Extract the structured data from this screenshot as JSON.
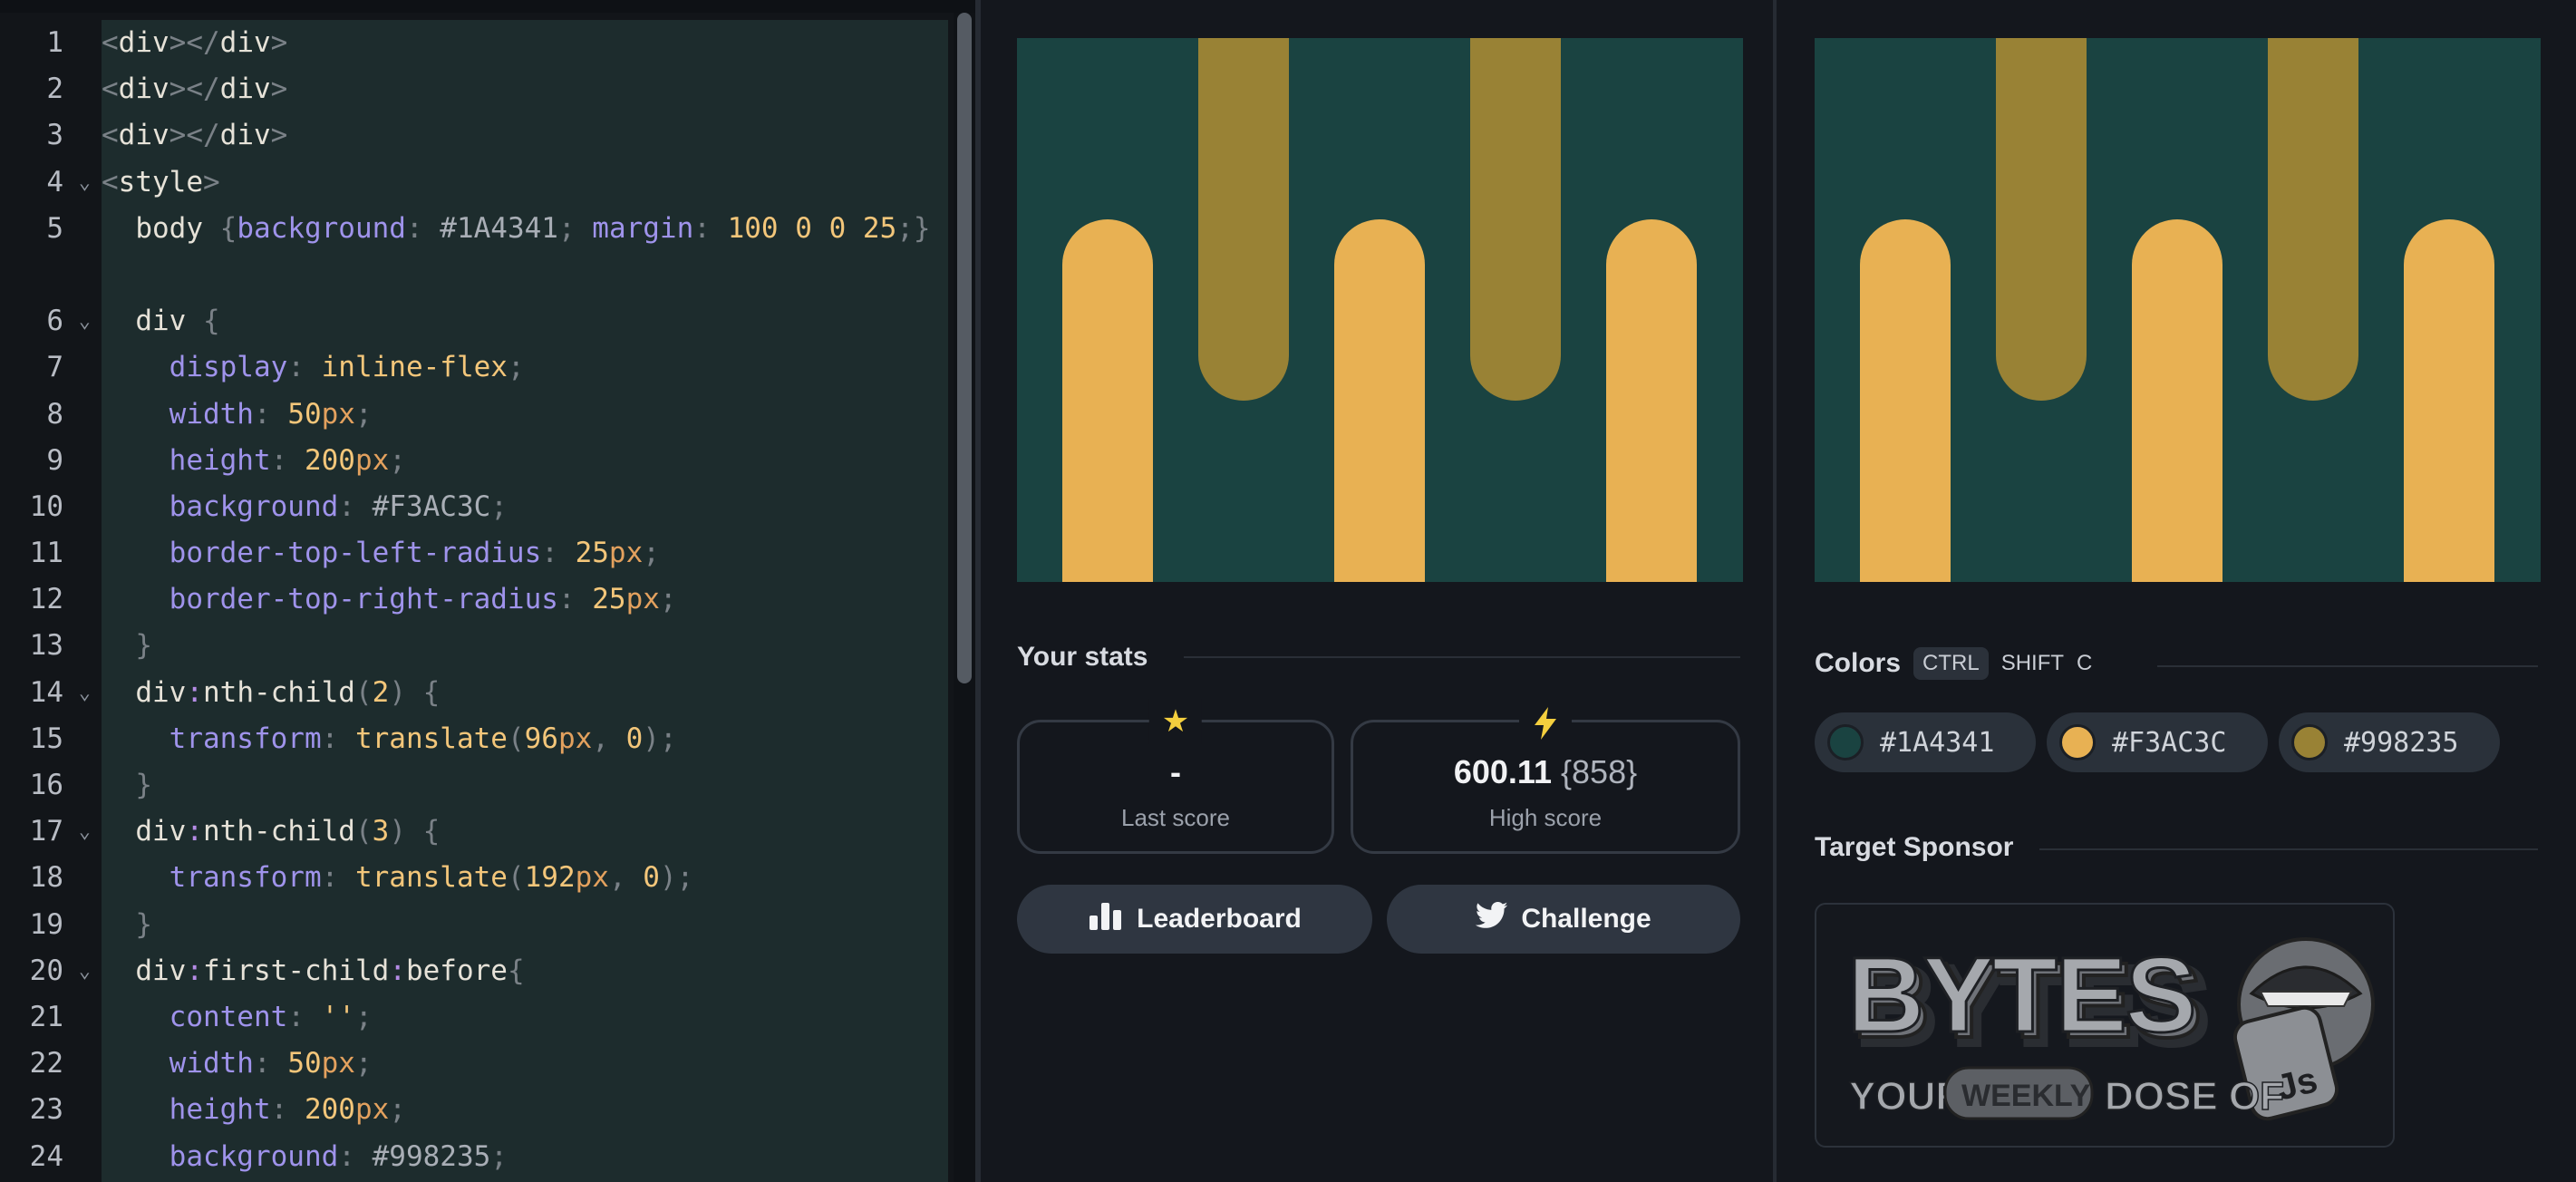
{
  "editor": {
    "lines": [
      {
        "n": "1",
        "fold": ""
      },
      {
        "n": "2",
        "fold": ""
      },
      {
        "n": "3",
        "fold": ""
      },
      {
        "n": "4",
        "fold": "⌄"
      },
      {
        "n": "5",
        "fold": "",
        "wrap": true
      },
      {
        "n": "6",
        "fold": "⌄"
      },
      {
        "n": "7",
        "fold": ""
      },
      {
        "n": "8",
        "fold": ""
      },
      {
        "n": "9",
        "fold": ""
      },
      {
        "n": "10",
        "fold": ""
      },
      {
        "n": "11",
        "fold": ""
      },
      {
        "n": "12",
        "fold": ""
      },
      {
        "n": "13",
        "fold": ""
      },
      {
        "n": "14",
        "fold": "⌄"
      },
      {
        "n": "15",
        "fold": ""
      },
      {
        "n": "16",
        "fold": ""
      },
      {
        "n": "17",
        "fold": "⌄"
      },
      {
        "n": "18",
        "fold": ""
      },
      {
        "n": "19",
        "fold": ""
      },
      {
        "n": "20",
        "fold": "⌄"
      },
      {
        "n": "21",
        "fold": ""
      },
      {
        "n": "22",
        "fold": ""
      },
      {
        "n": "23",
        "fold": ""
      },
      {
        "n": "24",
        "fold": ""
      }
    ],
    "code": [
      [
        [
          "pn",
          "<"
        ],
        [
          "sel",
          "div"
        ],
        [
          "pn",
          "></"
        ],
        [
          "sel",
          "div"
        ],
        [
          "pn",
          ">"
        ]
      ],
      [
        [
          "pn",
          "<"
        ],
        [
          "sel",
          "div"
        ],
        [
          "pn",
          "></"
        ],
        [
          "sel",
          "div"
        ],
        [
          "pn",
          ">"
        ]
      ],
      [
        [
          "pn",
          "<"
        ],
        [
          "sel",
          "div"
        ],
        [
          "pn",
          "></"
        ],
        [
          "sel",
          "div"
        ],
        [
          "pn",
          ">"
        ]
      ],
      [
        [
          "pn",
          "<"
        ],
        [
          "sel",
          "style"
        ],
        [
          "pn",
          ">"
        ]
      ],
      [
        [
          "sel",
          "  body "
        ],
        [
          "pn",
          "{"
        ],
        [
          "pr",
          "background"
        ],
        [
          "pn",
          ": "
        ],
        [
          "hx",
          "#1A4341"
        ],
        [
          "pn",
          "; "
        ],
        [
          "pr",
          "margin"
        ],
        [
          "pn",
          ": "
        ],
        [
          "vl",
          "100 0 0 25"
        ],
        [
          "pn",
          ";}"
        ]
      ],
      [
        [
          "sel",
          "  div "
        ],
        [
          "pn",
          "{"
        ]
      ],
      [
        [
          "sel",
          "    "
        ],
        [
          "pr",
          "display"
        ],
        [
          "pn",
          ": "
        ],
        [
          "vl",
          "inline-flex"
        ],
        [
          "pn",
          ";"
        ]
      ],
      [
        [
          "sel",
          "    "
        ],
        [
          "pr",
          "width"
        ],
        [
          "pn",
          ": "
        ],
        [
          "vl",
          "50"
        ],
        [
          "un",
          "px"
        ],
        [
          "pn",
          ";"
        ]
      ],
      [
        [
          "sel",
          "    "
        ],
        [
          "pr",
          "height"
        ],
        [
          "pn",
          ": "
        ],
        [
          "vl",
          "200"
        ],
        [
          "un",
          "px"
        ],
        [
          "pn",
          ";"
        ]
      ],
      [
        [
          "sel",
          "    "
        ],
        [
          "pr",
          "background"
        ],
        [
          "pn",
          ": "
        ],
        [
          "hx",
          "#F3AC3C"
        ],
        [
          "pn",
          ";"
        ]
      ],
      [
        [
          "sel",
          "    "
        ],
        [
          "pr",
          "border-top-left-radius"
        ],
        [
          "pn",
          ": "
        ],
        [
          "vl",
          "25"
        ],
        [
          "un",
          "px"
        ],
        [
          "pn",
          ";"
        ]
      ],
      [
        [
          "sel",
          "    "
        ],
        [
          "pr",
          "border-top-right-radius"
        ],
        [
          "pn",
          ": "
        ],
        [
          "vl",
          "25"
        ],
        [
          "un",
          "px"
        ],
        [
          "pn",
          ";"
        ]
      ],
      [
        [
          "sel",
          "  "
        ],
        [
          "pn",
          "}"
        ]
      ],
      [
        [
          "sel",
          "  div"
        ],
        [
          "pc",
          ":"
        ],
        [
          "sel",
          "nth-child"
        ],
        [
          "pn",
          "("
        ],
        [
          "vl",
          "2"
        ],
        [
          "pn",
          ") {"
        ]
      ],
      [
        [
          "sel",
          "    "
        ],
        [
          "pr",
          "transform"
        ],
        [
          "pn",
          ": "
        ],
        [
          "vl",
          "translate"
        ],
        [
          "pn",
          "("
        ],
        [
          "vl",
          "96"
        ],
        [
          "un",
          "px"
        ],
        [
          "pn",
          ", "
        ],
        [
          "vl",
          "0"
        ],
        [
          "pn",
          ");"
        ]
      ],
      [
        [
          "sel",
          "  "
        ],
        [
          "pn",
          "}"
        ]
      ],
      [
        [
          "sel",
          "  div"
        ],
        [
          "pc",
          ":"
        ],
        [
          "sel",
          "nth-child"
        ],
        [
          "pn",
          "("
        ],
        [
          "vl",
          "3"
        ],
        [
          "pn",
          ") {"
        ]
      ],
      [
        [
          "sel",
          "    "
        ],
        [
          "pr",
          "transform"
        ],
        [
          "pn",
          ": "
        ],
        [
          "vl",
          "translate"
        ],
        [
          "pn",
          "("
        ],
        [
          "vl",
          "192"
        ],
        [
          "un",
          "px"
        ],
        [
          "pn",
          ", "
        ],
        [
          "vl",
          "0"
        ],
        [
          "pn",
          ");"
        ]
      ],
      [
        [
          "sel",
          "  "
        ],
        [
          "pn",
          "}"
        ]
      ],
      [
        [
          "sel",
          "  div"
        ],
        [
          "pc",
          ":"
        ],
        [
          "sel",
          "first-child"
        ],
        [
          "pc",
          ":"
        ],
        [
          "sel",
          "before"
        ],
        [
          "pn",
          "{"
        ]
      ],
      [
        [
          "sel",
          "    "
        ],
        [
          "pr",
          "content"
        ],
        [
          "pn",
          ": "
        ],
        [
          "vl",
          "''"
        ],
        [
          "pn",
          ";"
        ]
      ],
      [
        [
          "sel",
          "    "
        ],
        [
          "pr",
          "width"
        ],
        [
          "pn",
          ": "
        ],
        [
          "vl",
          "50"
        ],
        [
          "un",
          "px"
        ],
        [
          "pn",
          ";"
        ]
      ],
      [
        [
          "sel",
          "    "
        ],
        [
          "pr",
          "height"
        ],
        [
          "pn",
          ": "
        ],
        [
          "vl",
          "200"
        ],
        [
          "un",
          "px"
        ],
        [
          "pn",
          ";"
        ]
      ],
      [
        [
          "sel",
          "    "
        ],
        [
          "pr",
          "background"
        ],
        [
          "pn",
          ": "
        ],
        [
          "hx",
          "#998235"
        ],
        [
          "pn",
          ";"
        ]
      ]
    ]
  },
  "target_colors": {
    "background": "#1A4341",
    "primary": "#F3AC3C",
    "secondary": "#998235"
  },
  "stats": {
    "title": "Your stats",
    "last": {
      "icon": "star-icon",
      "value": "-",
      "label": "Last score"
    },
    "high": {
      "icon": "lightning-icon",
      "value": "600.11",
      "sub": "{858}",
      "label": "High score"
    },
    "leaderboard_label": "Leaderboard",
    "challenge_label": "Challenge"
  },
  "colors": {
    "title": "Colors",
    "shortcut": [
      "CTRL",
      "SHIFT",
      "C"
    ],
    "chips": [
      "#1A4341",
      "#F3AC3C",
      "#998235"
    ]
  },
  "sponsor": {
    "title": "Target Sponsor",
    "logo_text": "BYTES",
    "tagline_1": "YOUR",
    "tagline_2": "WEEKLY",
    "tagline_3": "DOSE OF",
    "badge": "Js"
  }
}
